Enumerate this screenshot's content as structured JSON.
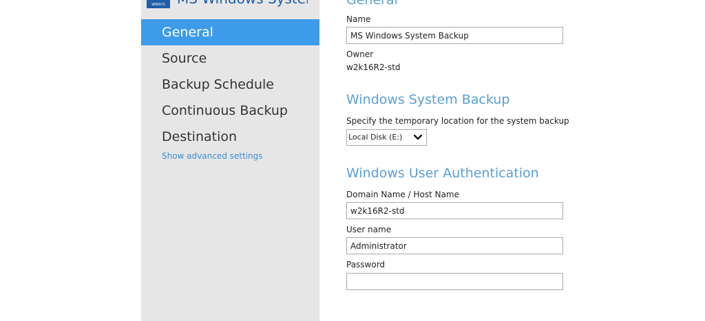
{
  "app": {
    "logo_text": "WINSYS",
    "title": "MS Windows System..."
  },
  "sidebar": {
    "items": [
      {
        "label": "General"
      },
      {
        "label": "Source"
      },
      {
        "label": "Backup Schedule"
      },
      {
        "label": "Continuous Backup"
      },
      {
        "label": "Destination"
      }
    ],
    "active_index": 0,
    "advanced_link": "Show advanced settings"
  },
  "general": {
    "title": "General",
    "name_label": "Name",
    "name_value": "MS Windows System Backup",
    "owner_label": "Owner",
    "owner_value": "w2k16R2-std"
  },
  "windows_system_backup": {
    "title": "Windows System Backup",
    "location_label": "Specify the temporary location for the system backup",
    "location_value": "Local Disk (E:)"
  },
  "windows_user_auth": {
    "title": "Windows User Authentication",
    "domain_label": "Domain Name / Host Name",
    "domain_value": "w2k16R2-std",
    "username_label": "User name",
    "username_value": "Administrator",
    "password_label": "Password",
    "password_value": ""
  },
  "colors": {
    "sidebar_bg": "#e6e6e6",
    "active_item_bg": "#3d9be9",
    "section_title": "#5a9fd4",
    "link": "#3d8fd6",
    "brand": "#1f5da8"
  },
  "icons": {
    "select_chevron": "chevron-down-icon"
  }
}
